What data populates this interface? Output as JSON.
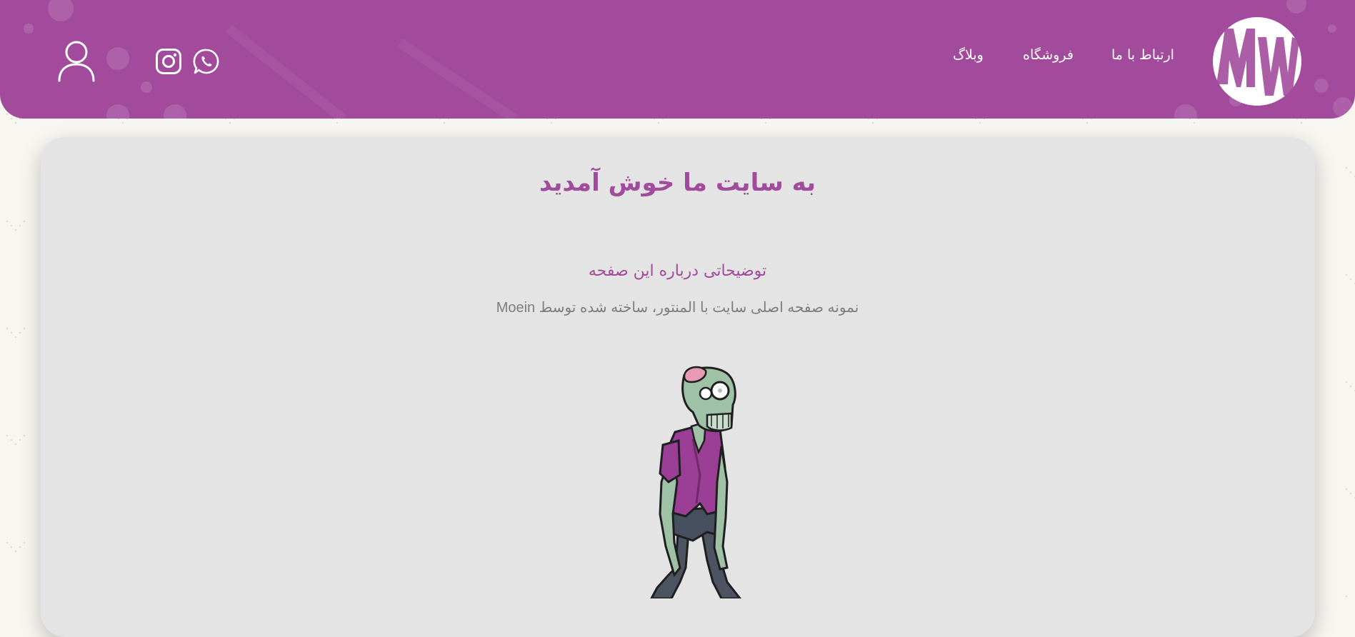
{
  "header": {
    "logo_alt": "MW",
    "nav": [
      {
        "label": "ارتباط با ما"
      },
      {
        "label": "فروشگاه"
      },
      {
        "label": "وبلاگ"
      }
    ],
    "icons": [
      "whatsapp-icon",
      "instagram-icon",
      "user-icon"
    ]
  },
  "main": {
    "title": "به سایت ما خوش آمدید",
    "subtitle": "توضیحاتی درباره این صفحه",
    "description": "نمونه صفحه اصلی سایت با المنتور، ساخته شده توسط Moein",
    "illustration": "zombie-illustration"
  },
  "colors": {
    "brand": "#a24b9c",
    "card": "#e4e4e4",
    "muted_text": "#7d7d7d"
  }
}
